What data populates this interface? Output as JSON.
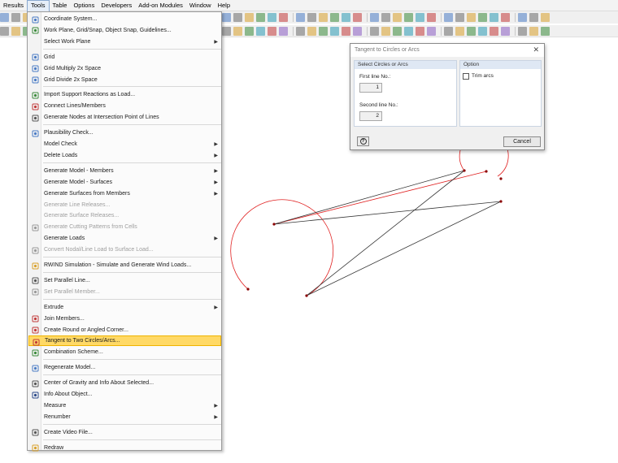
{
  "menubar": {
    "items": [
      "Results",
      "Tools",
      "Table",
      "Options",
      "Developers",
      "Add-on Modules",
      "Window",
      "Help"
    ],
    "active": "Tools"
  },
  "tools_menu": {
    "items": [
      {
        "label": "Coordinate System...",
        "icon": "coordinate-system-icon",
        "submenu": false,
        "disabled": false
      },
      {
        "label": "Work Plane, Grid/Snap, Object Snap, Guidelines...",
        "icon": "work-plane-icon",
        "submenu": false,
        "disabled": false
      },
      {
        "label": "Select Work Plane",
        "icon": "",
        "submenu": true,
        "disabled": false
      },
      {
        "label": "Grid",
        "icon": "grid-icon",
        "submenu": false,
        "disabled": false
      },
      {
        "label": "Grid Multiply 2x Space",
        "icon": "grid-multiply-icon",
        "submenu": false,
        "disabled": false
      },
      {
        "label": "Grid Divide 2x Space",
        "icon": "grid-divide-icon",
        "submenu": false,
        "disabled": false
      },
      {
        "label": "Import Support Reactions as Load...",
        "icon": "import-reactions-icon",
        "submenu": false,
        "disabled": false
      },
      {
        "label": "Connect Lines/Members",
        "icon": "connect-lines-icon",
        "submenu": false,
        "disabled": false
      },
      {
        "label": "Generate Nodes at Intersection Point of Lines",
        "icon": "intersection-nodes-icon",
        "submenu": false,
        "disabled": false
      },
      {
        "label": "Plausibility Check...",
        "icon": "plausibility-check-icon",
        "submenu": false,
        "disabled": false
      },
      {
        "label": "Model Check",
        "icon": "",
        "submenu": true,
        "disabled": false
      },
      {
        "label": "Delete Loads",
        "icon": "",
        "submenu": true,
        "disabled": false
      },
      {
        "label": "Generate Model - Members",
        "icon": "",
        "submenu": true,
        "disabled": false
      },
      {
        "label": "Generate Model - Surfaces",
        "icon": "",
        "submenu": true,
        "disabled": false
      },
      {
        "label": "Generate Surfaces from Members",
        "icon": "",
        "submenu": true,
        "disabled": false
      },
      {
        "label": "Generate Line Releases...",
        "icon": "",
        "submenu": false,
        "disabled": true
      },
      {
        "label": "Generate Surface Releases...",
        "icon": "",
        "submenu": false,
        "disabled": true
      },
      {
        "label": "Generate Cutting Patterns from Cells",
        "icon": "cutting-patterns-icon",
        "submenu": false,
        "disabled": true
      },
      {
        "label": "Generate Loads",
        "icon": "",
        "submenu": true,
        "disabled": false
      },
      {
        "label": "Convert Nodal/Line Load to Surface Load...",
        "icon": "convert-load-icon",
        "submenu": false,
        "disabled": true
      },
      {
        "label": "RWIND Simulation - Simulate and Generate Wind Loads...",
        "icon": "rwind-icon",
        "submenu": false,
        "disabled": false
      },
      {
        "label": "Set Parallel Line...",
        "icon": "parallel-line-icon",
        "submenu": false,
        "disabled": false
      },
      {
        "label": "Set Parallel Member...",
        "icon": "parallel-member-icon",
        "submenu": false,
        "disabled": true
      },
      {
        "label": "Extrude",
        "icon": "",
        "submenu": true,
        "disabled": false
      },
      {
        "label": "Join Members...",
        "icon": "join-members-icon",
        "submenu": false,
        "disabled": false
      },
      {
        "label": "Create Round or Angled Corner...",
        "icon": "round-corner-icon",
        "submenu": false,
        "disabled": false
      },
      {
        "label": "Tangent to Two Circles/Arcs...",
        "icon": "tangent-circles-icon",
        "submenu": false,
        "disabled": false,
        "highlighted": true
      },
      {
        "label": "Combination Scheme...",
        "icon": "combination-scheme-icon",
        "submenu": false,
        "disabled": false
      },
      {
        "label": "Regenerate Model...",
        "icon": "regenerate-icon",
        "submenu": false,
        "disabled": false
      },
      {
        "label": "Center of Gravity and Info About Selected...",
        "icon": "center-of-gravity-icon",
        "submenu": false,
        "disabled": false
      },
      {
        "label": "Info About Object...",
        "icon": "info-icon",
        "submenu": false,
        "disabled": false
      },
      {
        "label": "Measure",
        "icon": "",
        "submenu": true,
        "disabled": false
      },
      {
        "label": "Renumber",
        "icon": "",
        "submenu": true,
        "disabled": false
      },
      {
        "label": "Create Video File...",
        "icon": "video-icon",
        "submenu": false,
        "disabled": false
      },
      {
        "label": "Redraw",
        "icon": "redraw-icon",
        "submenu": false,
        "disabled": false
      }
    ]
  },
  "dialog": {
    "title": "Tangent to Circles or Arcs",
    "group_select": "Select Circles or Arcs",
    "first_line_label": "First line No.:",
    "first_line_value": "1",
    "second_line_label": "Second line No.:",
    "second_line_value": "2",
    "group_option": "Option",
    "trim_arcs_label": "Trim arcs",
    "trim_arcs_checked": false,
    "help_icon": "help-icon",
    "cancel_label": "Cancel"
  },
  "colors": {
    "arc_red": "#e02020",
    "tangent_line": "#333333",
    "menu_highlight": "#ffd966"
  }
}
